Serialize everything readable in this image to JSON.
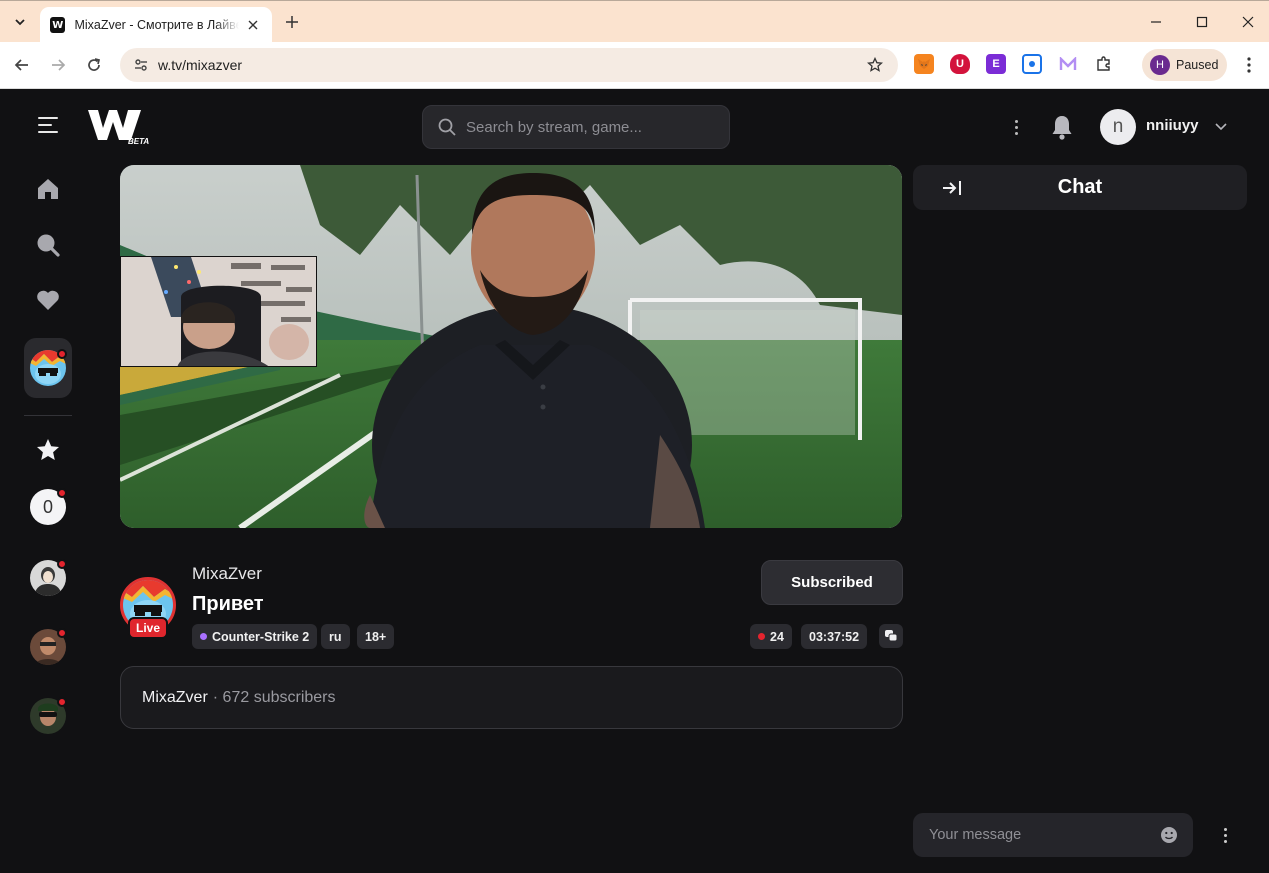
{
  "browser": {
    "tab_title": "MixaZver - Смотрите в Лайве на W",
    "url": "w.tv/mixazver",
    "profile_initial": "H",
    "profile_status": "Paused"
  },
  "site": {
    "logo_beta": "BETA",
    "search_placeholder": "Search by stream, game...",
    "user_initial": "n",
    "user_name": "nniiuyy",
    "sidebar_follow_count": "0"
  },
  "stream": {
    "streamer": "MixaZver",
    "title": "Привет",
    "live_label": "Live",
    "tags": [
      "Counter-Strike 2",
      "ru",
      "18+"
    ],
    "subscribe_label": "Subscribed",
    "viewers": "24",
    "uptime": "03:37:52",
    "about_name": "MixaZver",
    "about_subscribers": "· 672 subscribers"
  },
  "chat": {
    "title": "Chat",
    "input_placeholder": "Your message"
  },
  "colors": {
    "live_red": "#e0262d",
    "game_dot": "#a970ff",
    "page_bg": "#111113"
  }
}
